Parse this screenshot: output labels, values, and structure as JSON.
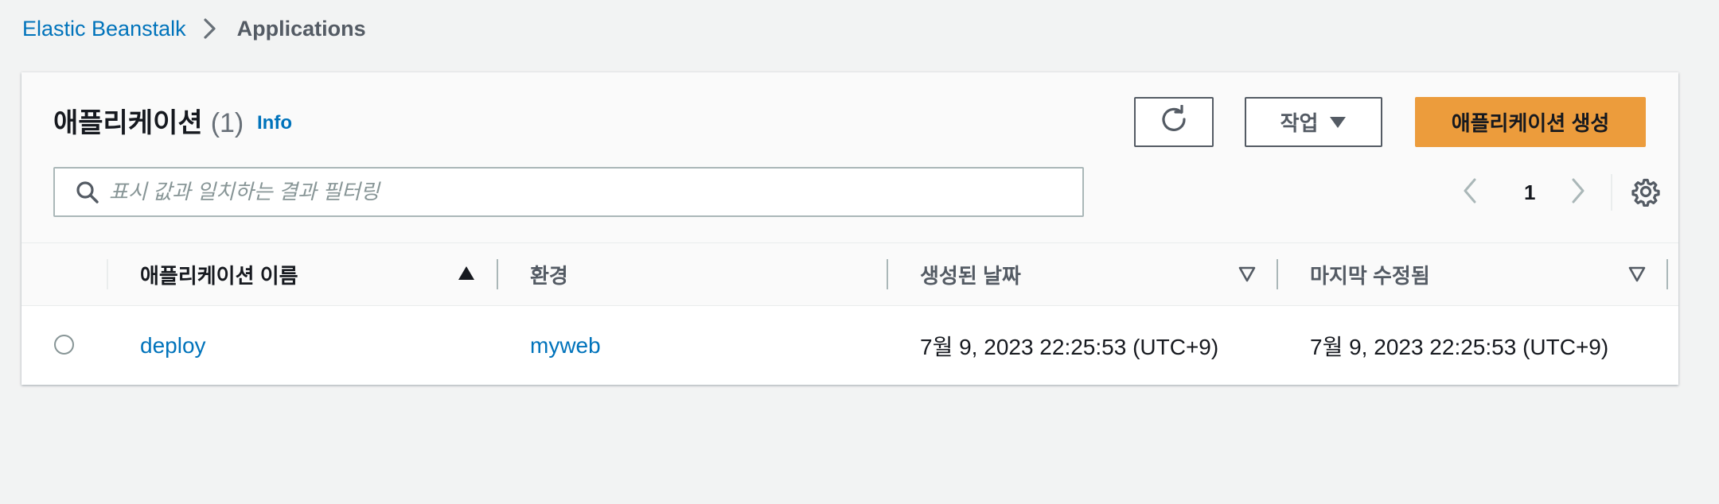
{
  "breadcrumb": {
    "root": "Elastic Beanstalk",
    "current": "Applications"
  },
  "header": {
    "title": "애플리케이션",
    "count": "(1)",
    "info": "Info"
  },
  "toolbar": {
    "refresh_icon": "refresh-icon",
    "actions_label": "작업",
    "create_label": "애플리케이션 생성"
  },
  "search": {
    "placeholder": "표시 값과 일치하는 결과 필터링",
    "value": ""
  },
  "pagination": {
    "current_page": "1"
  },
  "table": {
    "columns": [
      {
        "label": "애플리케이션 이름",
        "sort": "ascending"
      },
      {
        "label": "환경",
        "sort": "none"
      },
      {
        "label": "생성된 날짜",
        "sort": "sortable"
      },
      {
        "label": "마지막 수정됨",
        "sort": "sortable"
      }
    ],
    "rows": [
      {
        "name": "deploy",
        "environment": "myweb",
        "created": "7월 9, 2023 22:25:53 (UTC+9)",
        "modified": "7월 9, 2023 22:25:53 (UTC+9)",
        "selected": false
      }
    ]
  },
  "colors": {
    "link": "#0073bb",
    "primary_button": "#ec9c3c",
    "background": "#f2f3f3",
    "text": "#16191f",
    "secondary_text": "#545b64"
  }
}
